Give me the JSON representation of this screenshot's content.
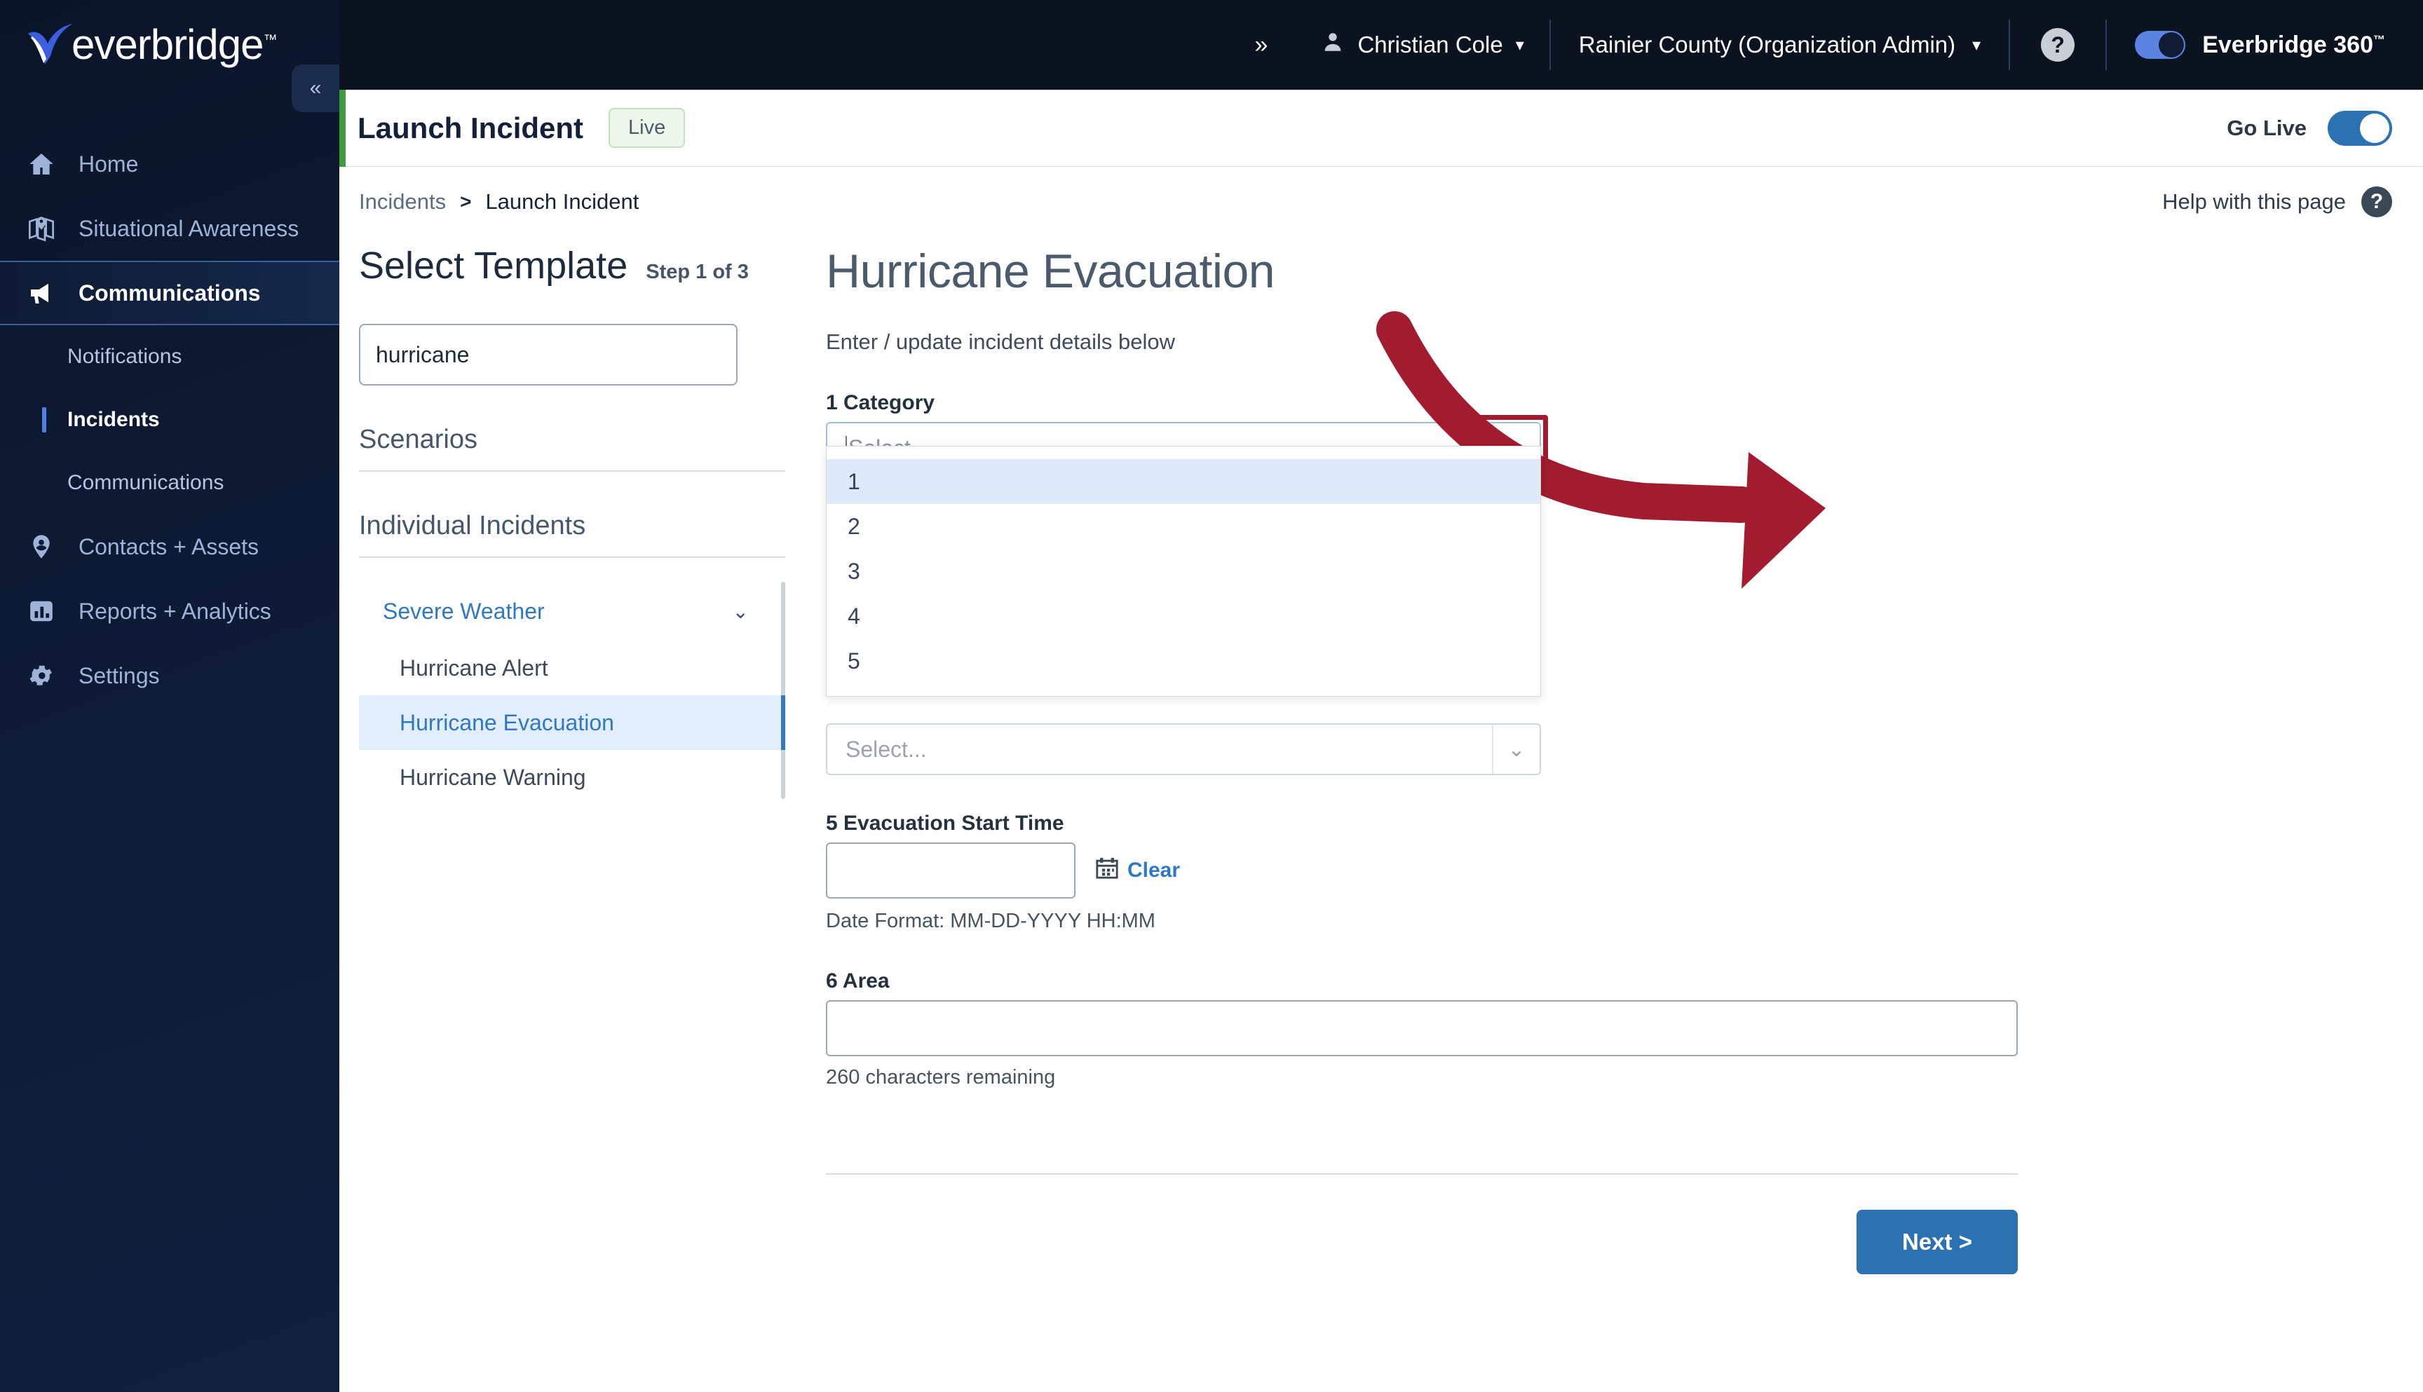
{
  "brand": {
    "logo_text": "everbridge",
    "logo_tm": "™"
  },
  "topbar": {
    "expand_icon": "»",
    "user_name": "Christian Cole",
    "user_caret": "▾",
    "org_name": "Rainier County (Organization Admin)",
    "org_caret": "▾",
    "help_glyph": "?",
    "brand_bold": "Everbridge 360",
    "brand_tm": "™"
  },
  "sidebar": {
    "collapse_icon": "«",
    "items": [
      {
        "label": "Home",
        "icon": "home-icon",
        "active": false
      },
      {
        "label": "Situational Awareness",
        "icon": "map-pin-icon",
        "active": false
      },
      {
        "label": "Communications",
        "icon": "megaphone-icon",
        "active": true
      },
      {
        "label": "Contacts + Assets",
        "icon": "person-pin-icon",
        "active": false
      },
      {
        "label": "Reports + Analytics",
        "icon": "bar-chart-icon",
        "active": false
      },
      {
        "label": "Settings",
        "icon": "gear-icon",
        "active": false
      }
    ],
    "subitems": [
      {
        "label": "Notifications",
        "active": false
      },
      {
        "label": "Incidents",
        "active": true
      },
      {
        "label": "Communications",
        "active": false
      }
    ]
  },
  "pagebar": {
    "title": "Launch Incident",
    "live_badge": "Live",
    "go_live_label": "Go Live",
    "go_live_on": true
  },
  "breadcrumb": {
    "parent": "Incidents",
    "separator": ">",
    "current": "Launch Incident",
    "help_label": "Help with this page",
    "help_glyph": "?"
  },
  "left_panel": {
    "step_title": "Select Template",
    "step_progress": "Step 1 of 3",
    "search_value": "hurricane",
    "search_placeholder": "",
    "scenarios_heading": "Scenarios",
    "individual_heading": "Individual Incidents",
    "group": {
      "label": "Severe Weather",
      "chevron": "⌄",
      "expanded": true
    },
    "templates": [
      {
        "label": "Hurricane Alert",
        "selected": false
      },
      {
        "label": "Hurricane Evacuation",
        "selected": true
      },
      {
        "label": "Hurricane Warning",
        "selected": false
      }
    ]
  },
  "form": {
    "title": "Hurricane Evacuation",
    "subtitle": "Enter / update incident details below",
    "category": {
      "label": "1 Category",
      "value": "",
      "placeholder": "Select...",
      "chevron": "⌄",
      "open": true,
      "options": [
        "1",
        "2",
        "3",
        "4",
        "5"
      ],
      "highlighted_option": "1"
    },
    "hidden_select": {
      "placeholder": "Select...",
      "chevron": "⌄"
    },
    "evacuation_start_time": {
      "label": "5 Evacuation Start Time",
      "value": "",
      "clear_label": "Clear",
      "calendar_icon": "calendar-icon",
      "date_hint": "Date Format: MM-DD-YYYY HH:MM"
    },
    "area": {
      "label": "6 Area",
      "value": "",
      "counter": "260 characters remaining"
    },
    "next_label": "Next >"
  },
  "annotation": {
    "arrow_color": "#a31b2e",
    "box_color": "#a31b2e"
  }
}
